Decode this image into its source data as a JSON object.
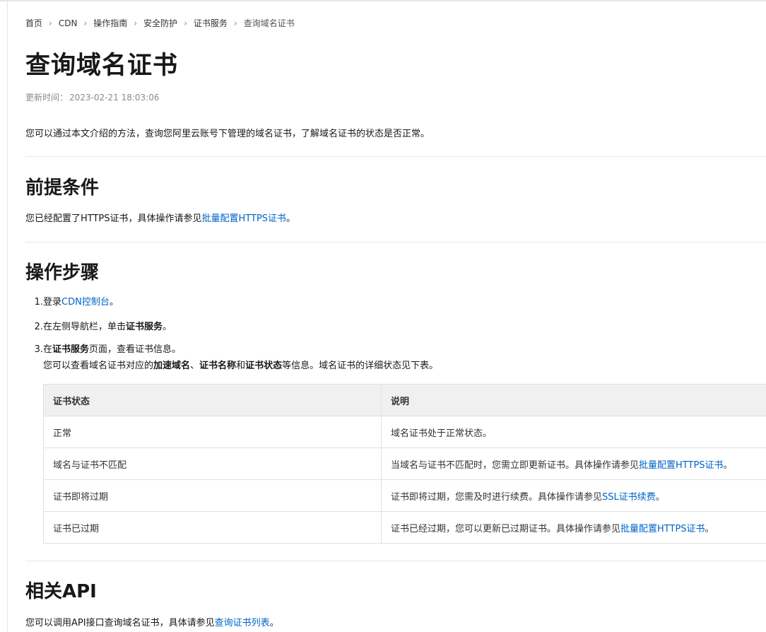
{
  "breadcrumb": [
    "首页",
    "CDN",
    "操作指南",
    "安全防护",
    "证书服务",
    "查询域名证书"
  ],
  "title": "查询域名证书",
  "updated_label": "更新时间：",
  "updated_value": "2023-02-21 18:03:06",
  "intro": "您可以通过本文介绍的方法，查询您阿里云账号下管理的域名证书，了解域名证书的状态是否正常。",
  "prereq": {
    "heading": "前提条件",
    "text_before": "您已经配置了HTTPS证书，具体操作请参见",
    "link": "批量配置HTTPS证书",
    "text_after": "。"
  },
  "steps_section": {
    "heading": "操作步骤",
    "step1": {
      "num": "1.",
      "text_before": "登录",
      "link": "CDN控制台",
      "text_after": "。"
    },
    "step2": {
      "num": "2.",
      "text_before": "在左侧导航栏，单击",
      "bold": "证书服务",
      "text_after": "。"
    },
    "step3": {
      "num": "3.",
      "text_before": "在",
      "bold": "证书服务",
      "text_after": "页面，查看证书信息。",
      "sub": {
        "t1": "您可以查看域名证书对应的",
        "b1": "加速域名",
        "t2": "、",
        "b2": "证书名称",
        "t3": "和",
        "b3": "证书状态",
        "t4": "等信息。域名证书的详细状态见下表。"
      }
    }
  },
  "table": {
    "headers": [
      "证书状态",
      "说明"
    ],
    "rows": [
      {
        "status": "正常",
        "desc_before": "域名证书处于正常状态。",
        "link": "",
        "desc_after": ""
      },
      {
        "status": "域名与证书不匹配",
        "desc_before": "当域名与证书不匹配时，您需立即更新证书。具体操作请参见",
        "link": "批量配置HTTPS证书",
        "desc_after": "。"
      },
      {
        "status": "证书即将过期",
        "desc_before": "证书即将过期，您需及时进行续费。具体操作请参见",
        "link": "SSL证书续费",
        "desc_after": "。"
      },
      {
        "status": "证书已过期",
        "desc_before": "证书已经过期，您可以更新已过期证书。具体操作请参见",
        "link": "批量配置HTTPS证书",
        "desc_after": "。"
      }
    ]
  },
  "api": {
    "heading": "相关API",
    "text_before": "您可以调用API接口查询域名证书，具体请参见",
    "link": "查询证书列表",
    "text_after": "。"
  },
  "colors": {
    "link": "#0064c8",
    "text": "#181818",
    "muted": "#8a8a8a"
  }
}
